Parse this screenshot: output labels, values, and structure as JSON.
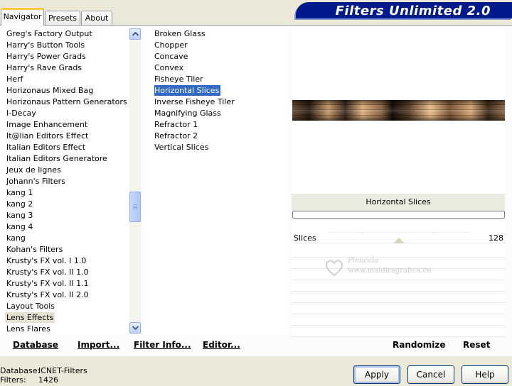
{
  "tabs": [
    {
      "label": "Navigator",
      "active": true
    },
    {
      "label": "Presets",
      "active": false
    },
    {
      "label": "About",
      "active": false
    }
  ],
  "title": "Filters Unlimited 2.0",
  "categories": [
    "Greg's Factory Output",
    "Harry's Button Tools",
    "Harry's Power Grads",
    "Harry's Rave Grads",
    "Herf",
    "Horizonaus Mixed Bag",
    "Horizonaus Pattern Generators",
    "I-Decay",
    "Image Enhancement",
    "It@lian Editors Effect",
    "Italian Editors Effect",
    "Italian Editors Generatore",
    "Jeux de lignes",
    "Johann's Filters",
    "kang 1",
    "kang 2",
    "kang 3",
    "kang 4",
    "kang",
    "Kohan's Filters",
    "Krusty's FX vol. I 1.0",
    "Krusty's FX vol. II 1.0",
    "Krusty's FX vol. II 1.1",
    "Krusty's FX vol. II 2.0",
    "Layout Tools",
    "Lens Effects",
    "Lens Flares"
  ],
  "selected_category": "Lens Effects",
  "filters": [
    "Broken Glass",
    "Chopper",
    "Concave",
    "Convex",
    "Fisheye Tiler",
    "Horizontal Slices",
    "Inverse Fisheye Tiler",
    "Magnifying Glass",
    "Refractor 1",
    "Refractor 2",
    "Vertical Slices"
  ],
  "selected_filter": "Horizontal Slices",
  "current_filter_title": "Horizontal Slices",
  "params": [
    {
      "label": "Slices",
      "value": "128"
    }
  ],
  "watermark": {
    "line1": "Pinuccia",
    "line2": "www.maidiragrafica.eu"
  },
  "toolbar": {
    "database": "Database",
    "import": "Import...",
    "filter_info": "Filter Info...",
    "editor": "Editor...",
    "randomize": "Randomize",
    "reset": "Reset"
  },
  "status": {
    "database_label": "Database:",
    "database_value": "ICNET-Filters",
    "filters_label": "Filters:",
    "filters_value": "1426"
  },
  "buttons": {
    "apply": "Apply",
    "cancel": "Cancel",
    "help": "Help"
  },
  "colors": {
    "selection": "#316ac5",
    "banner": "#001a8c",
    "tab_highlight": "#ffc83c"
  }
}
